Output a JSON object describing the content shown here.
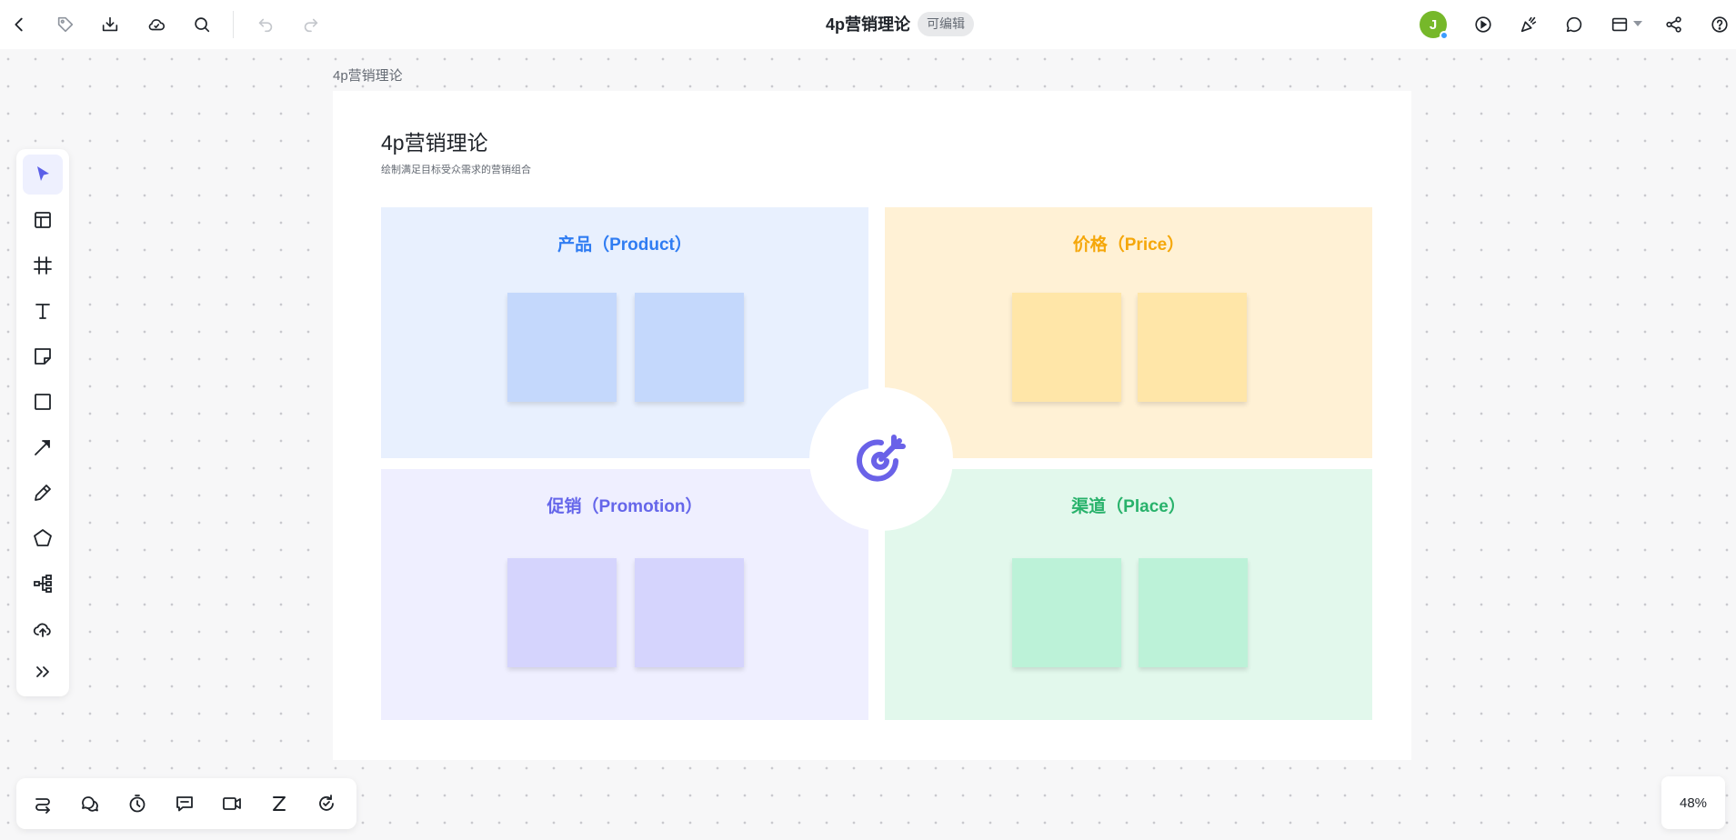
{
  "header": {
    "title": "4p营销理论",
    "badge": "可编辑",
    "avatar_letter": "J",
    "left_icons": [
      "back-icon",
      "tag-icon",
      "download-icon",
      "cloud-icon",
      "search-icon",
      "undo-icon",
      "redo-icon"
    ],
    "right_icons": [
      "play-icon",
      "celebrate-icon",
      "comment-icon",
      "layout-icon",
      "share-icon",
      "help-icon"
    ]
  },
  "frame": {
    "label": "4p营销理论"
  },
  "board": {
    "title": "4p营销理论",
    "subtitle": "绘制满足目标受众需求的营销组合",
    "quadrants": [
      {
        "title": "产品（Product）",
        "color": "#2f7cf2",
        "bg": "#e8f0fe",
        "note_color": "#c4d8fc"
      },
      {
        "title": "价格（Price）",
        "color": "#f5a70a",
        "bg": "#fff1d5",
        "note_color": "#ffe6a8"
      },
      {
        "title": "促销（Promotion）",
        "color": "#6566ea",
        "bg": "#efefff",
        "note_color": "#d5d4fd"
      },
      {
        "title": "渠道（Place）",
        "color": "#28b26b",
        "bg": "#e2f8ec",
        "note_color": "#bcf2d8"
      }
    ],
    "center_icon": "target-icon",
    "center_color": "#6a62e8"
  },
  "left_toolbar": [
    "select-icon",
    "template-icon",
    "frame-icon",
    "text-icon",
    "sticky-note-icon",
    "rectangle-icon",
    "line-icon",
    "pen-icon",
    "shape-icon",
    "mindmap-icon",
    "upload-icon",
    "more-icon"
  ],
  "bottom_toolbar": [
    "connector-icon",
    "chat-icon",
    "timer-icon",
    "comment-box-icon",
    "video-icon",
    "sleep-icon",
    "sync-icon"
  ],
  "zoom": "48%"
}
